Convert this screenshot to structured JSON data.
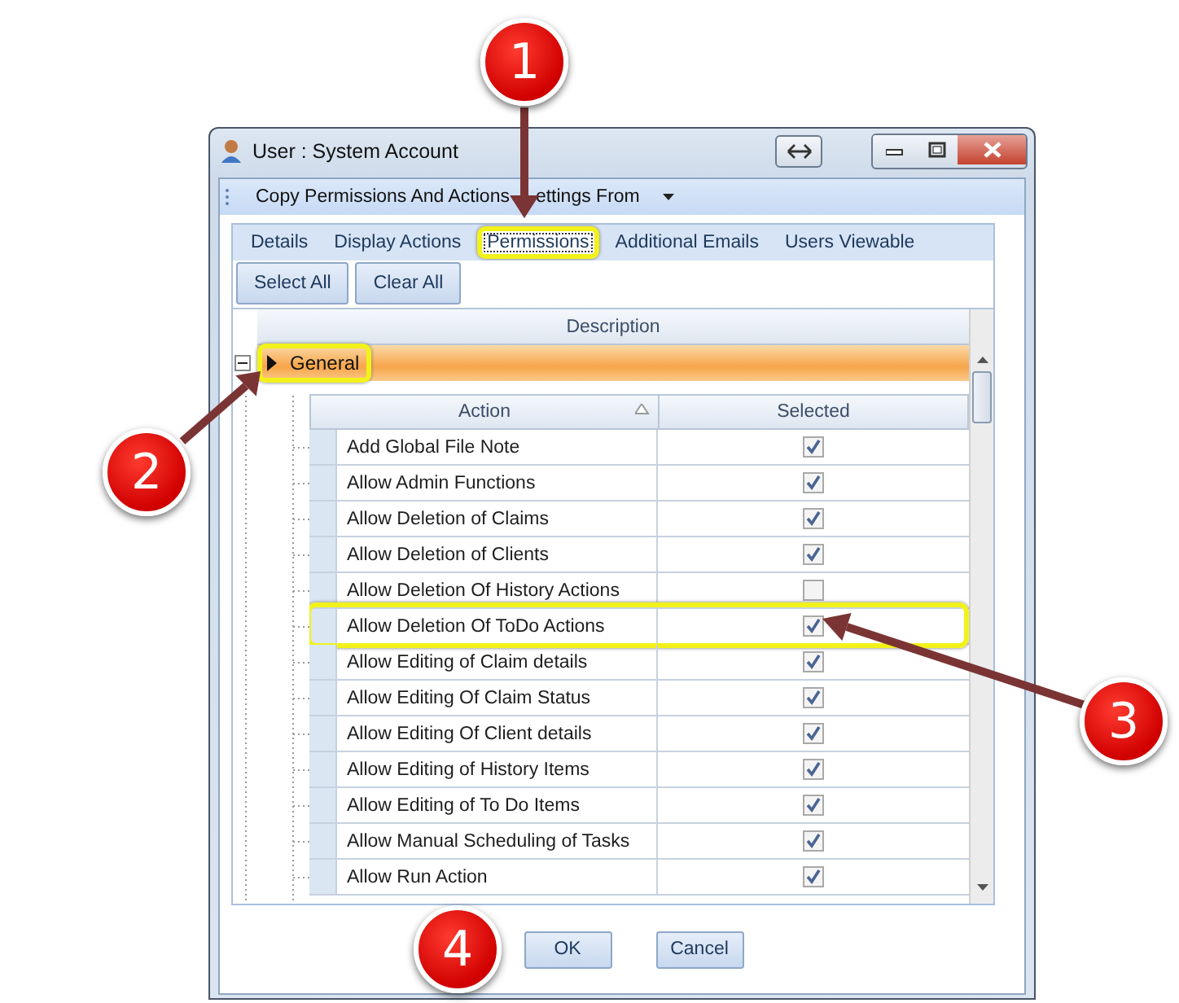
{
  "window": {
    "title": "User : System Account"
  },
  "toolbar": {
    "label_parts": [
      "Copy Permissions And Actions",
      "ettings From"
    ]
  },
  "tabs": [
    {
      "label": "Details",
      "selected": false,
      "highlighted": false
    },
    {
      "label": "Display Actions",
      "selected": false,
      "highlighted": false
    },
    {
      "label": "Permissions",
      "selected": true,
      "highlighted": true
    },
    {
      "label": "Additional Emails",
      "selected": false,
      "highlighted": false
    },
    {
      "label": "Users Viewable",
      "selected": false,
      "highlighted": false
    }
  ],
  "buttons": [
    "Select All",
    "Clear All"
  ],
  "grid": {
    "header": "Description",
    "group": {
      "name": "General",
      "expanded": true,
      "highlighted": true
    },
    "columns": [
      "Action",
      "Selected"
    ],
    "rows": [
      {
        "action": "Add Global File Note",
        "checked": true,
        "highlighted": false
      },
      {
        "action": "Allow Admin Functions",
        "checked": true,
        "highlighted": false
      },
      {
        "action": "Allow Deletion of Claims",
        "checked": true,
        "highlighted": false
      },
      {
        "action": "Allow Deletion of Clients",
        "checked": true,
        "highlighted": false
      },
      {
        "action": "Allow Deletion Of History Actions",
        "checked": false,
        "highlighted": false
      },
      {
        "action": "Allow Deletion Of ToDo Actions",
        "checked": true,
        "highlighted": true
      },
      {
        "action": "Allow Editing of Claim details",
        "checked": true,
        "highlighted": false
      },
      {
        "action": "Allow Editing Of Claim Status",
        "checked": true,
        "highlighted": false
      },
      {
        "action": "Allow Editing Of Client details",
        "checked": true,
        "highlighted": false
      },
      {
        "action": "Allow Editing of History Items",
        "checked": true,
        "highlighted": false
      },
      {
        "action": "Allow Editing of To Do Items",
        "checked": true,
        "highlighted": false
      },
      {
        "action": "Allow Manual Scheduling of Tasks",
        "checked": true,
        "highlighted": false
      },
      {
        "action": "Allow Run Action",
        "checked": true,
        "highlighted": false
      }
    ]
  },
  "footer_buttons": [
    "OK",
    "Cancel"
  ],
  "callouts": [
    {
      "number": "1",
      "kind": "arrow"
    },
    {
      "number": "2",
      "kind": "arrow"
    },
    {
      "number": "3",
      "kind": "arrow"
    },
    {
      "number": "4",
      "kind": "plain"
    }
  ]
}
